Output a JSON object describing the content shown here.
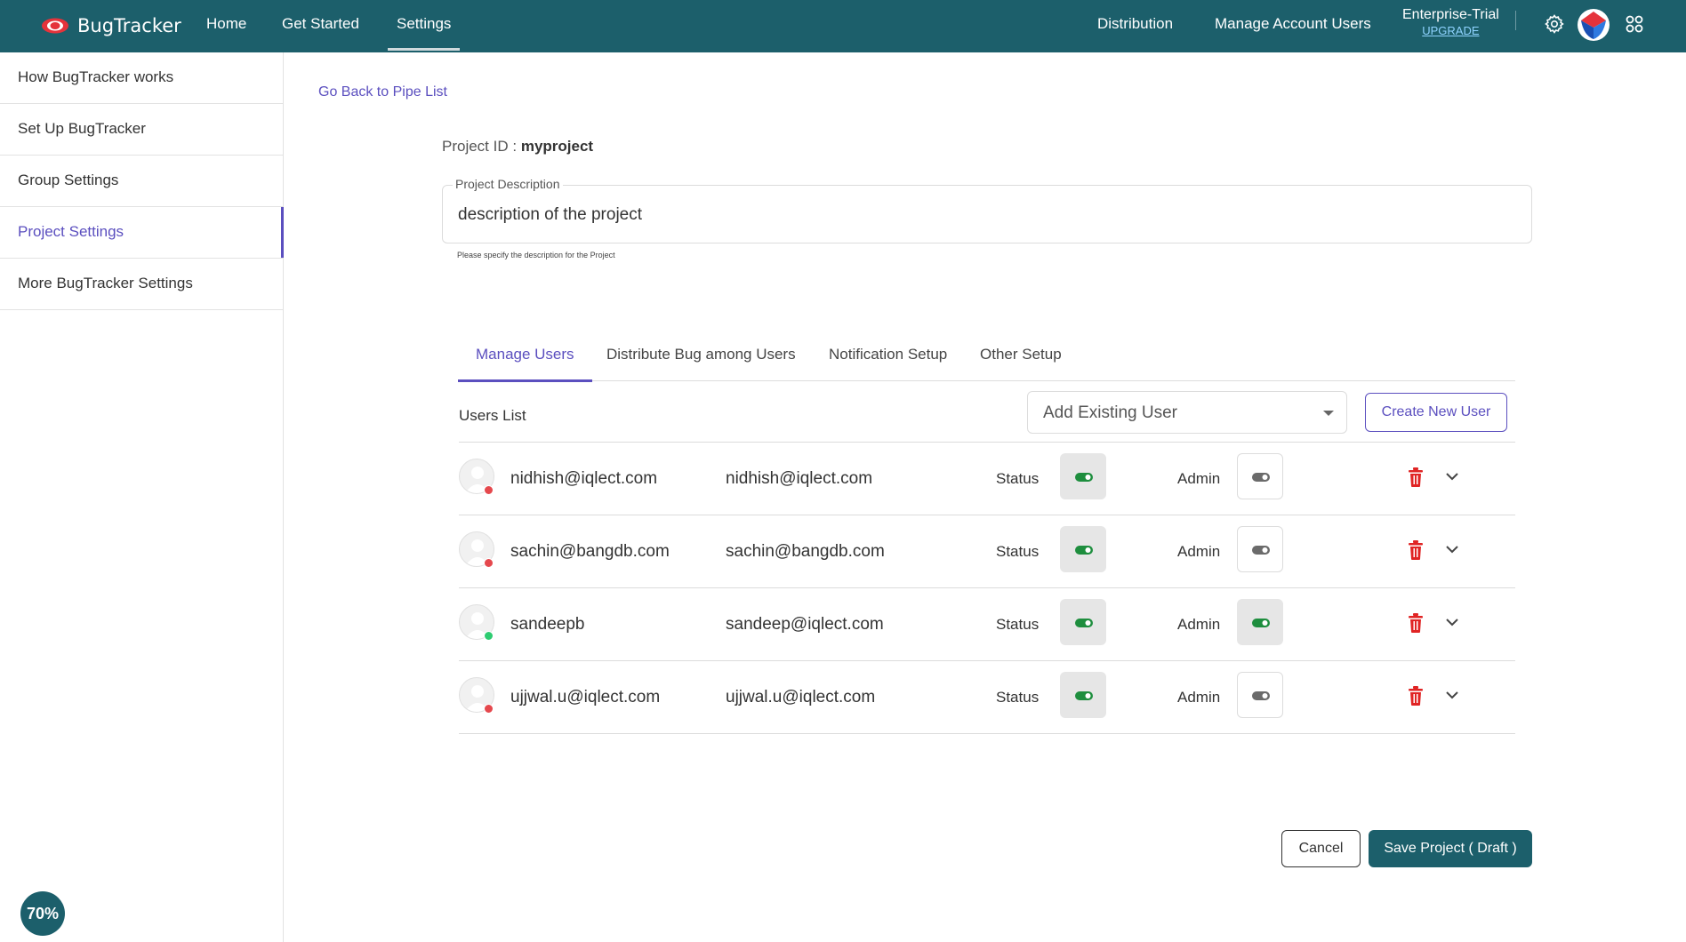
{
  "app": {
    "name": "BugTracker",
    "accent_color": "#1c5f6b",
    "link_color": "#5b4fbf"
  },
  "topnav": {
    "left": [
      {
        "label": "Home",
        "active": false
      },
      {
        "label": "Get Started",
        "active": false
      },
      {
        "label": "Settings",
        "active": true
      }
    ],
    "right": [
      {
        "label": "Distribution"
      },
      {
        "label": "Manage Account Users"
      }
    ],
    "plan": {
      "name": "Enterprise-Trial",
      "upgrade_label": "UPGRADE"
    },
    "icons": [
      "gear-icon",
      "account-logo",
      "apps-grid-icon"
    ]
  },
  "sidebar": {
    "items": [
      {
        "label": "How BugTracker works",
        "active": false
      },
      {
        "label": "Set Up BugTracker",
        "active": false
      },
      {
        "label": "Group Settings",
        "active": false
      },
      {
        "label": "Project Settings",
        "active": true
      },
      {
        "label": "More BugTracker Settings",
        "active": false
      }
    ],
    "progress": "70%"
  },
  "main": {
    "back_link": "Go Back to Pipe List",
    "project_id_label": "Project ID :",
    "project_id_value": "myproject",
    "description": {
      "label": "Project Description",
      "value": "description of the project",
      "help": "Please specify the description for the Project"
    },
    "tabs": [
      {
        "label": "Manage Users",
        "active": true
      },
      {
        "label": "Distribute Bug among Users",
        "active": false
      },
      {
        "label": "Notification Setup",
        "active": false
      },
      {
        "label": "Other Setup",
        "active": false
      }
    ],
    "users_list_title": "Users List",
    "add_existing_user": "Add Existing User",
    "create_new_user": "Create New User",
    "status_label": "Status",
    "admin_label": "Admin",
    "users": [
      {
        "name": "nidhish@iqlect.com",
        "email": "nidhish@iqlect.com",
        "online": false,
        "status_on": true,
        "admin_on": false
      },
      {
        "name": "sachin@bangdb.com",
        "email": "sachin@bangdb.com",
        "online": false,
        "status_on": true,
        "admin_on": false
      },
      {
        "name": "sandeepb",
        "email": "sandeep@iqlect.com",
        "online": true,
        "status_on": true,
        "admin_on": true
      },
      {
        "name": "ujjwal.u@iqlect.com",
        "email": "ujjwal.u@iqlect.com",
        "online": false,
        "status_on": true,
        "admin_on": false
      }
    ],
    "actions": {
      "cancel": "Cancel",
      "save": "Save Project ( Draft )"
    }
  }
}
